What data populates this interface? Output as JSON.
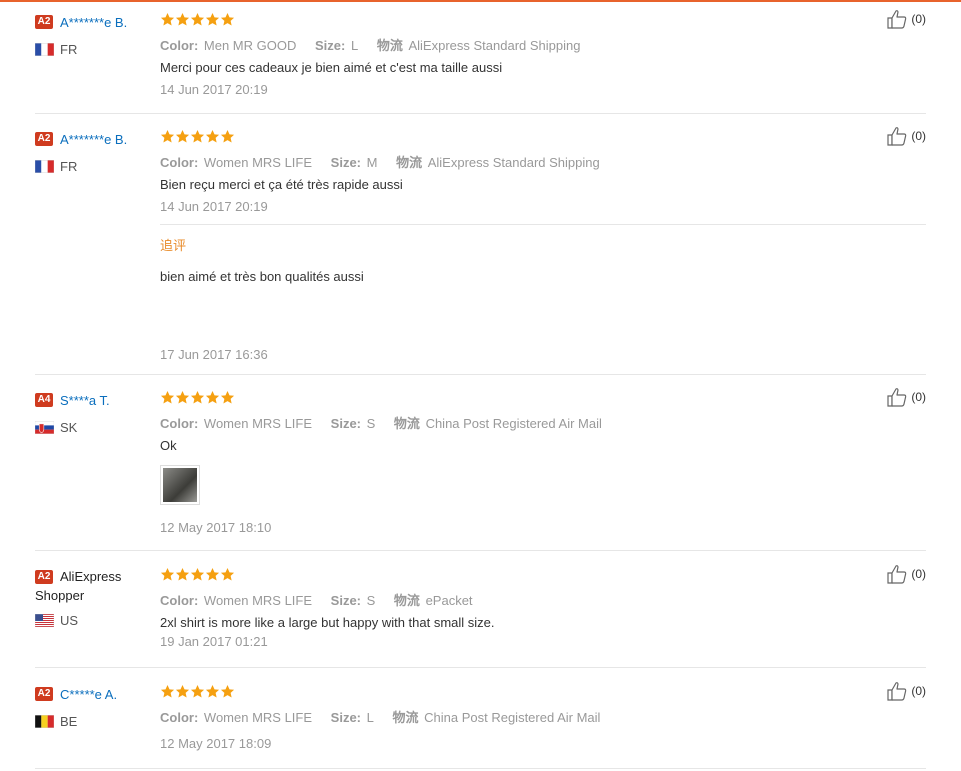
{
  "colors": {
    "accent": "#e8632c",
    "star": "#f5a011",
    "link": "#0a6ebd",
    "badge": "#cf3b1f",
    "followup": "#e88b2a"
  },
  "labels": {
    "color": "Color:",
    "size": "Size:",
    "shipping": "物流",
    "followup": "追评"
  },
  "reviews": [
    {
      "badge": "A2",
      "name": "A*******e B.",
      "country": "FR",
      "flag": "france-flag",
      "stars": 5,
      "color": "Men MR GOOD",
      "size": "L",
      "shipping": "AliExpress Standard Shipping",
      "text": "Merci pour ces cadeaux je bien aimé et c'est ma taille aussi",
      "date": "14 Jun 2017 20:19",
      "likes": "(0)"
    },
    {
      "badge": "A2",
      "name": "A*******e B.",
      "country": "FR",
      "flag": "france-flag",
      "stars": 5,
      "color": "Women MRS LIFE",
      "size": "M",
      "shipping": "AliExpress Standard Shipping",
      "text": "Bien reçu merci et ça été très rapide aussi",
      "date": "14 Jun 2017 20:19",
      "likes": "(0)",
      "followup_text": "bien aimé et très bon qualités aussi",
      "followup_date": "17 Jun 2017 16:36"
    },
    {
      "badge": "A4",
      "name": "S****a T.",
      "country": "SK",
      "flag": "slovakia-flag",
      "stars": 5,
      "color": "Women MRS LIFE",
      "size": "S",
      "shipping": "China Post Registered Air Mail",
      "text": "Ok",
      "has_photo": true,
      "date": "12 May 2017 18:10",
      "likes": "(0)"
    },
    {
      "badge": "A2",
      "name": "AliExpress Shopper",
      "country": "US",
      "flag": "usa-flag",
      "stars": 5,
      "color": "Women MRS LIFE",
      "size": "S",
      "shipping": "ePacket",
      "text": "2xl shirt is more like a large but happy with that small size.",
      "date": "19 Jan 2017 01:21",
      "likes": "(0)"
    },
    {
      "badge": "A2",
      "name": "C*****e A.",
      "country": "BE",
      "flag": "belgium-flag",
      "stars": 5,
      "color": "Women MRS LIFE",
      "size": "L",
      "shipping": "China Post Registered Air Mail",
      "text": "",
      "date": "12 May 2017 18:09",
      "likes": "(0)"
    }
  ]
}
